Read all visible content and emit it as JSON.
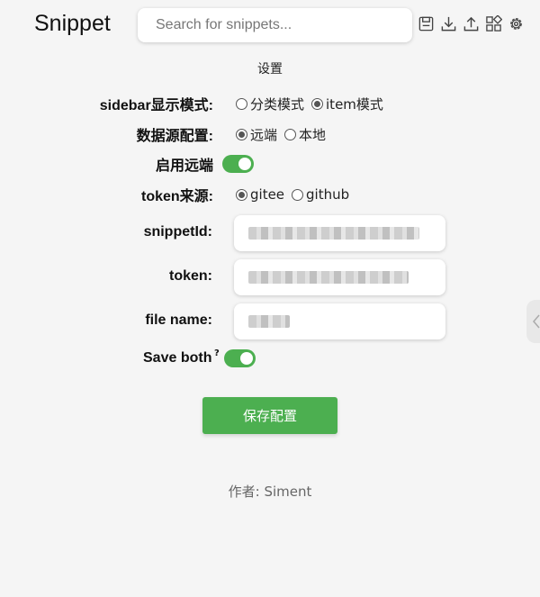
{
  "header": {
    "logo": "Snippet",
    "search_placeholder": "Search for snippets...",
    "toolbar_icons": [
      "save-icon",
      "download-icon",
      "upload-icon",
      "apps-icon",
      "gear-icon"
    ]
  },
  "settings": {
    "title": "设置",
    "sidebar_mode": {
      "label": "sidebar显示模式:",
      "options": [
        "分类模式",
        "item模式"
      ],
      "selected": "item模式"
    },
    "data_source": {
      "label": "数据源配置:",
      "options": [
        "远端",
        "本地"
      ],
      "selected": "远端"
    },
    "enable_remote": {
      "label": "启用远端",
      "enabled": true
    },
    "token_source": {
      "label": "token来源:",
      "options": [
        "gitee",
        "github"
      ],
      "selected": "gitee"
    },
    "snippet_id": {
      "label": "snippetId:"
    },
    "token": {
      "label": "token:"
    },
    "file_name": {
      "label": "file name:"
    },
    "save_both": {
      "label": "Save both",
      "help": "?",
      "enabled": true
    },
    "save_button": "保存配置"
  },
  "footer": {
    "author": "作者: Siment"
  },
  "colors": {
    "accent": "#4caf50",
    "background": "#f5f5f5"
  }
}
